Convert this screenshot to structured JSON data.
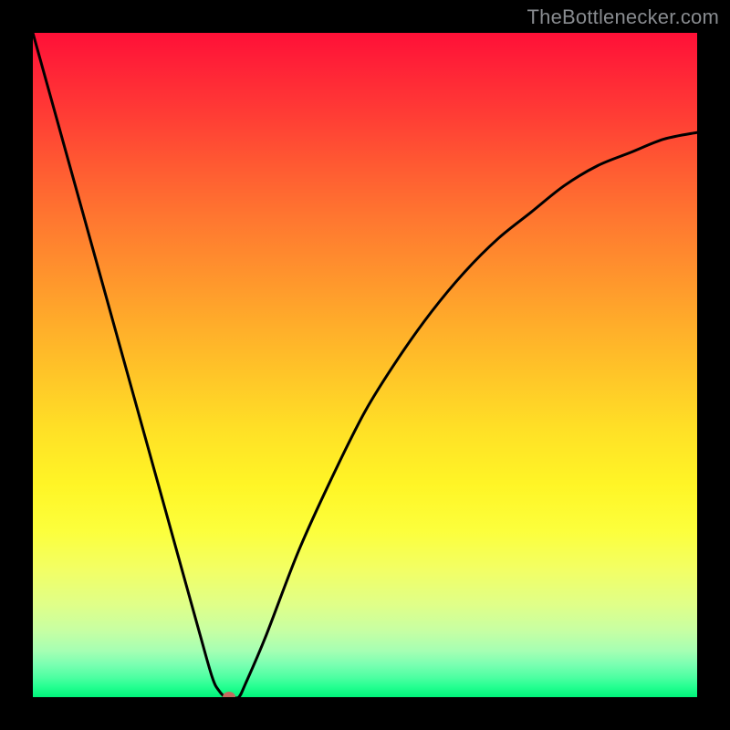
{
  "watermark": "TheBottlenecker.com",
  "chart_data": {
    "type": "line",
    "title": "",
    "xlabel": "",
    "ylabel": "",
    "xlim": [
      0,
      100
    ],
    "ylim": [
      0,
      100
    ],
    "x": [
      0,
      5,
      10,
      15,
      20,
      25,
      27,
      28,
      29,
      30,
      31,
      32,
      35,
      40,
      45,
      50,
      55,
      60,
      65,
      70,
      75,
      80,
      85,
      90,
      95,
      100
    ],
    "values": [
      100,
      82,
      64,
      46,
      28,
      10,
      3,
      1,
      0,
      0,
      0,
      2,
      9,
      22,
      33,
      43,
      51,
      58,
      64,
      69,
      73,
      77,
      80,
      82,
      84,
      85
    ],
    "marker": {
      "x": 29.5,
      "y": 0
    },
    "grid": false,
    "legend": false
  }
}
